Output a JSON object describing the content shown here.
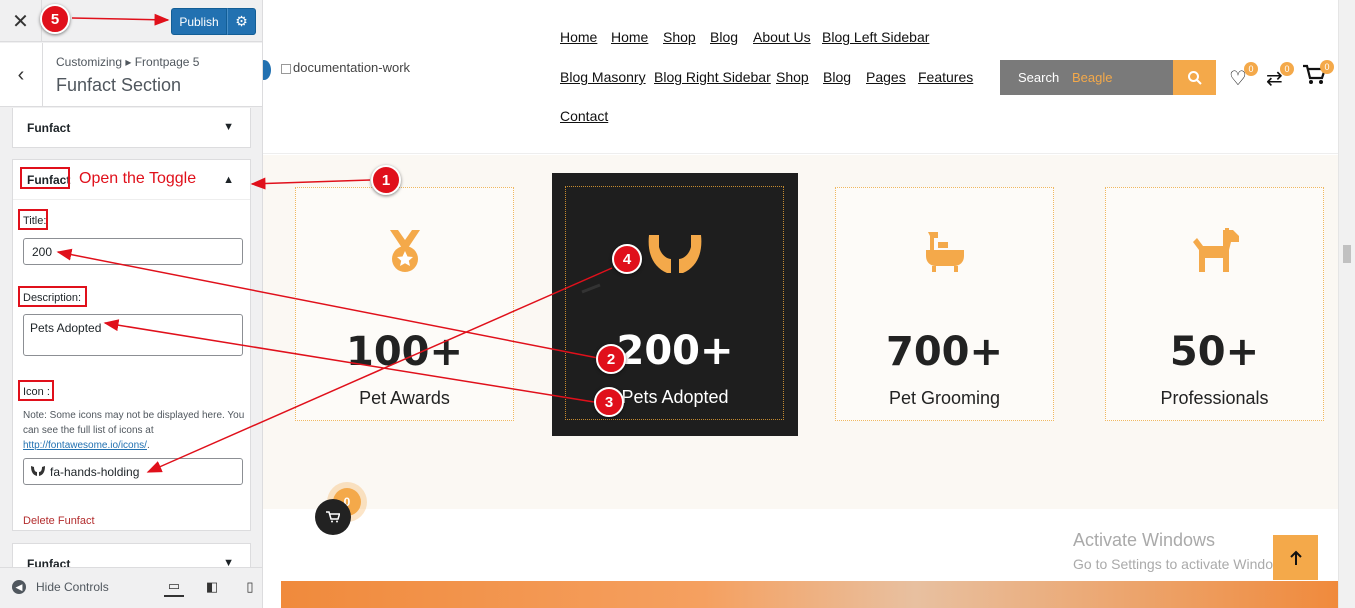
{
  "customizer": {
    "close": "✕",
    "publish_label": "Publish",
    "breadcrumb": "Customizing ▸ Frontpage 5",
    "section_title": "Funfact Section",
    "collapsed_panel_label": "Funfact",
    "open_panel_label": "Funfact",
    "toggle_note": "Open the Toggle",
    "fields": {
      "title_label": "Title:",
      "title_value": "200",
      "description_label": "Description:",
      "description_value": "Pets Adopted",
      "icon_label": "Icon :",
      "icon_note_prefix": "Note: Some icons may not be displayed here. You can see the full list of icons at ",
      "icon_note_link": "http://fontawesome.io/icons/",
      "icon_note_suffix": ".",
      "icon_value": "fa-hands-holding"
    },
    "delete_label": "Delete Funfact",
    "bottom_panel_label": "Funfact",
    "hide_controls_label": "Hide Controls"
  },
  "site": {
    "logo_alt": "documentation-work",
    "nav_row1": [
      "Home",
      "Home",
      "Shop",
      "Blog",
      "About Us",
      "Blog Left Sidebar"
    ],
    "nav_row2": [
      "Blog Masonry",
      "Blog Right Sidebar",
      "Shop",
      "Blog",
      "Pages",
      "Features"
    ],
    "nav_row3": [
      "Contact"
    ],
    "search_label": "Search",
    "search_value": "Beagle",
    "wishlist_count": "0",
    "compare_count": "0",
    "cart_count": "0",
    "funfacts": [
      {
        "number": "100+",
        "label": "Pet Awards",
        "icon": "medal-icon"
      },
      {
        "number": "200+",
        "label": "Pets Adopted",
        "icon": "hands-holding-icon"
      },
      {
        "number": "700+",
        "label": "Pet Grooming",
        "icon": "bath-icon"
      },
      {
        "number": "50+",
        "label": "Professionals",
        "icon": "dog-icon"
      }
    ],
    "float_cart_count": "0",
    "activate_title": "Activate Windows",
    "activate_sub": "Go to Settings to activate Windows."
  },
  "annotations": [
    "1",
    "2",
    "3",
    "4",
    "5"
  ],
  "colors": {
    "accent": "#f4a94a",
    "annotation_red": "#e0101b",
    "wp_blue": "#2271b1",
    "dark_card": "#1e1e1e"
  }
}
